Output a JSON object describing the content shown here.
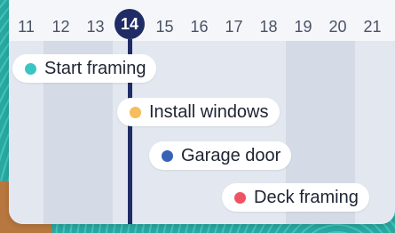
{
  "timeline": {
    "days": [
      "11",
      "12",
      "13",
      "14",
      "15",
      "16",
      "17",
      "18",
      "19",
      "20",
      "21"
    ],
    "today": "14",
    "tasks": [
      {
        "label": "Start framing",
        "color": "#3cc4c4"
      },
      {
        "label": "Install windows",
        "color": "#f5bd5b"
      },
      {
        "label": "Garage door",
        "color": "#3763b7"
      },
      {
        "label": "Deck framing",
        "color": "#ee5362"
      }
    ]
  }
}
